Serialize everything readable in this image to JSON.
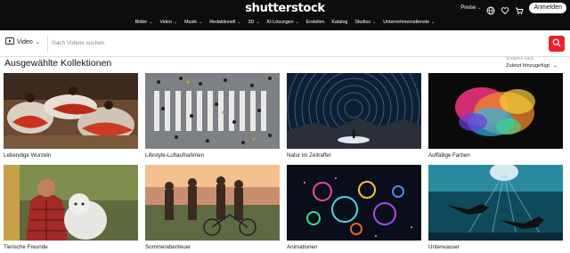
{
  "header": {
    "logo": "shutterstock",
    "prices": "Preise",
    "login": "Anmelden",
    "nav": [
      "Bilder",
      "Video",
      "Musik",
      "Redaktionell",
      "3D",
      "KI-Lösungen",
      "Erstellen",
      "Katalog",
      "Studios",
      "Unternehmensdienste"
    ]
  },
  "search": {
    "type": "Video",
    "placeholder": "Nach Videos suchen"
  },
  "section": {
    "title": "Ausgewählte Kollektionen",
    "sort_label": "Sortieren nach",
    "sort_value": "Zuletzt hinzugefügt"
  },
  "collections": [
    {
      "title": "Lebendige Wurzeln"
    },
    {
      "title": "Lifestyle-Luftaufnahmen"
    },
    {
      "title": "Natur im Zeitraffer"
    },
    {
      "title": "Auffällige Farben"
    },
    {
      "title": "Tierische Freunde"
    },
    {
      "title": "Sommerabenteuer"
    },
    {
      "title": "Animationen"
    },
    {
      "title": "Unterwasser"
    }
  ],
  "colors": {
    "accent": "#e8242b",
    "header_bg": "#0d0d0d"
  }
}
